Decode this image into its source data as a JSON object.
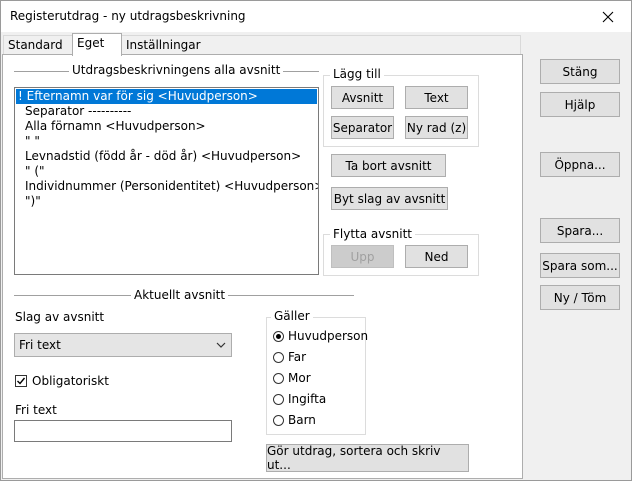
{
  "window": {
    "title": "Registerutdrag - ny utdragsbeskrivning"
  },
  "tabs": [
    {
      "label": "Standard"
    },
    {
      "label": "Eget"
    },
    {
      "label": "Inställningar"
    }
  ],
  "sections": {
    "all_parts_label": "Utdragsbeskrivningens alla avsnitt",
    "current_part_label": "Aktuellt avsnitt"
  },
  "parts_list": {
    "items": [
      "! Efternamn var för sig <Huvudperson>",
      "Separator ----------",
      "Alla förnamn <Huvudperson>",
      "\" \"",
      "Levnadstid (född år - död år) <Huvudperson>",
      "\" (\"",
      "Individnummer (Personidentitet) <Huvudperson>",
      "\")\""
    ]
  },
  "add_group": {
    "label": "Lägg till",
    "section_button": "Avsnitt",
    "text_button": "Text",
    "separator_button": "Separator",
    "newline_button": "Ny rad (z)"
  },
  "remove_button": "Ta bort avsnitt",
  "change_type_button": "Byt slag av avsnitt",
  "move_group": {
    "label": "Flytta avsnitt",
    "up_button": "Upp",
    "down_button": "Ned"
  },
  "part_type": {
    "label": "Slag av avsnitt",
    "value": "Fri text"
  },
  "mandatory": {
    "label": "Obligatoriskt",
    "checked": true
  },
  "free_text": {
    "label": "Fri text",
    "value": ""
  },
  "applies_to": {
    "label": "Gäller",
    "options": [
      "Huvudperson",
      "Far",
      "Mor",
      "Ingifta",
      "Barn"
    ],
    "selected": "Huvudperson"
  },
  "run_button": "Gör utdrag, sortera och skriv ut...",
  "side_buttons": {
    "close": "Stäng",
    "help": "Hjälp",
    "open": "Öppna...",
    "save": "Spara...",
    "save_as": "Spara som...",
    "new_clear": "Ny / Töm"
  }
}
